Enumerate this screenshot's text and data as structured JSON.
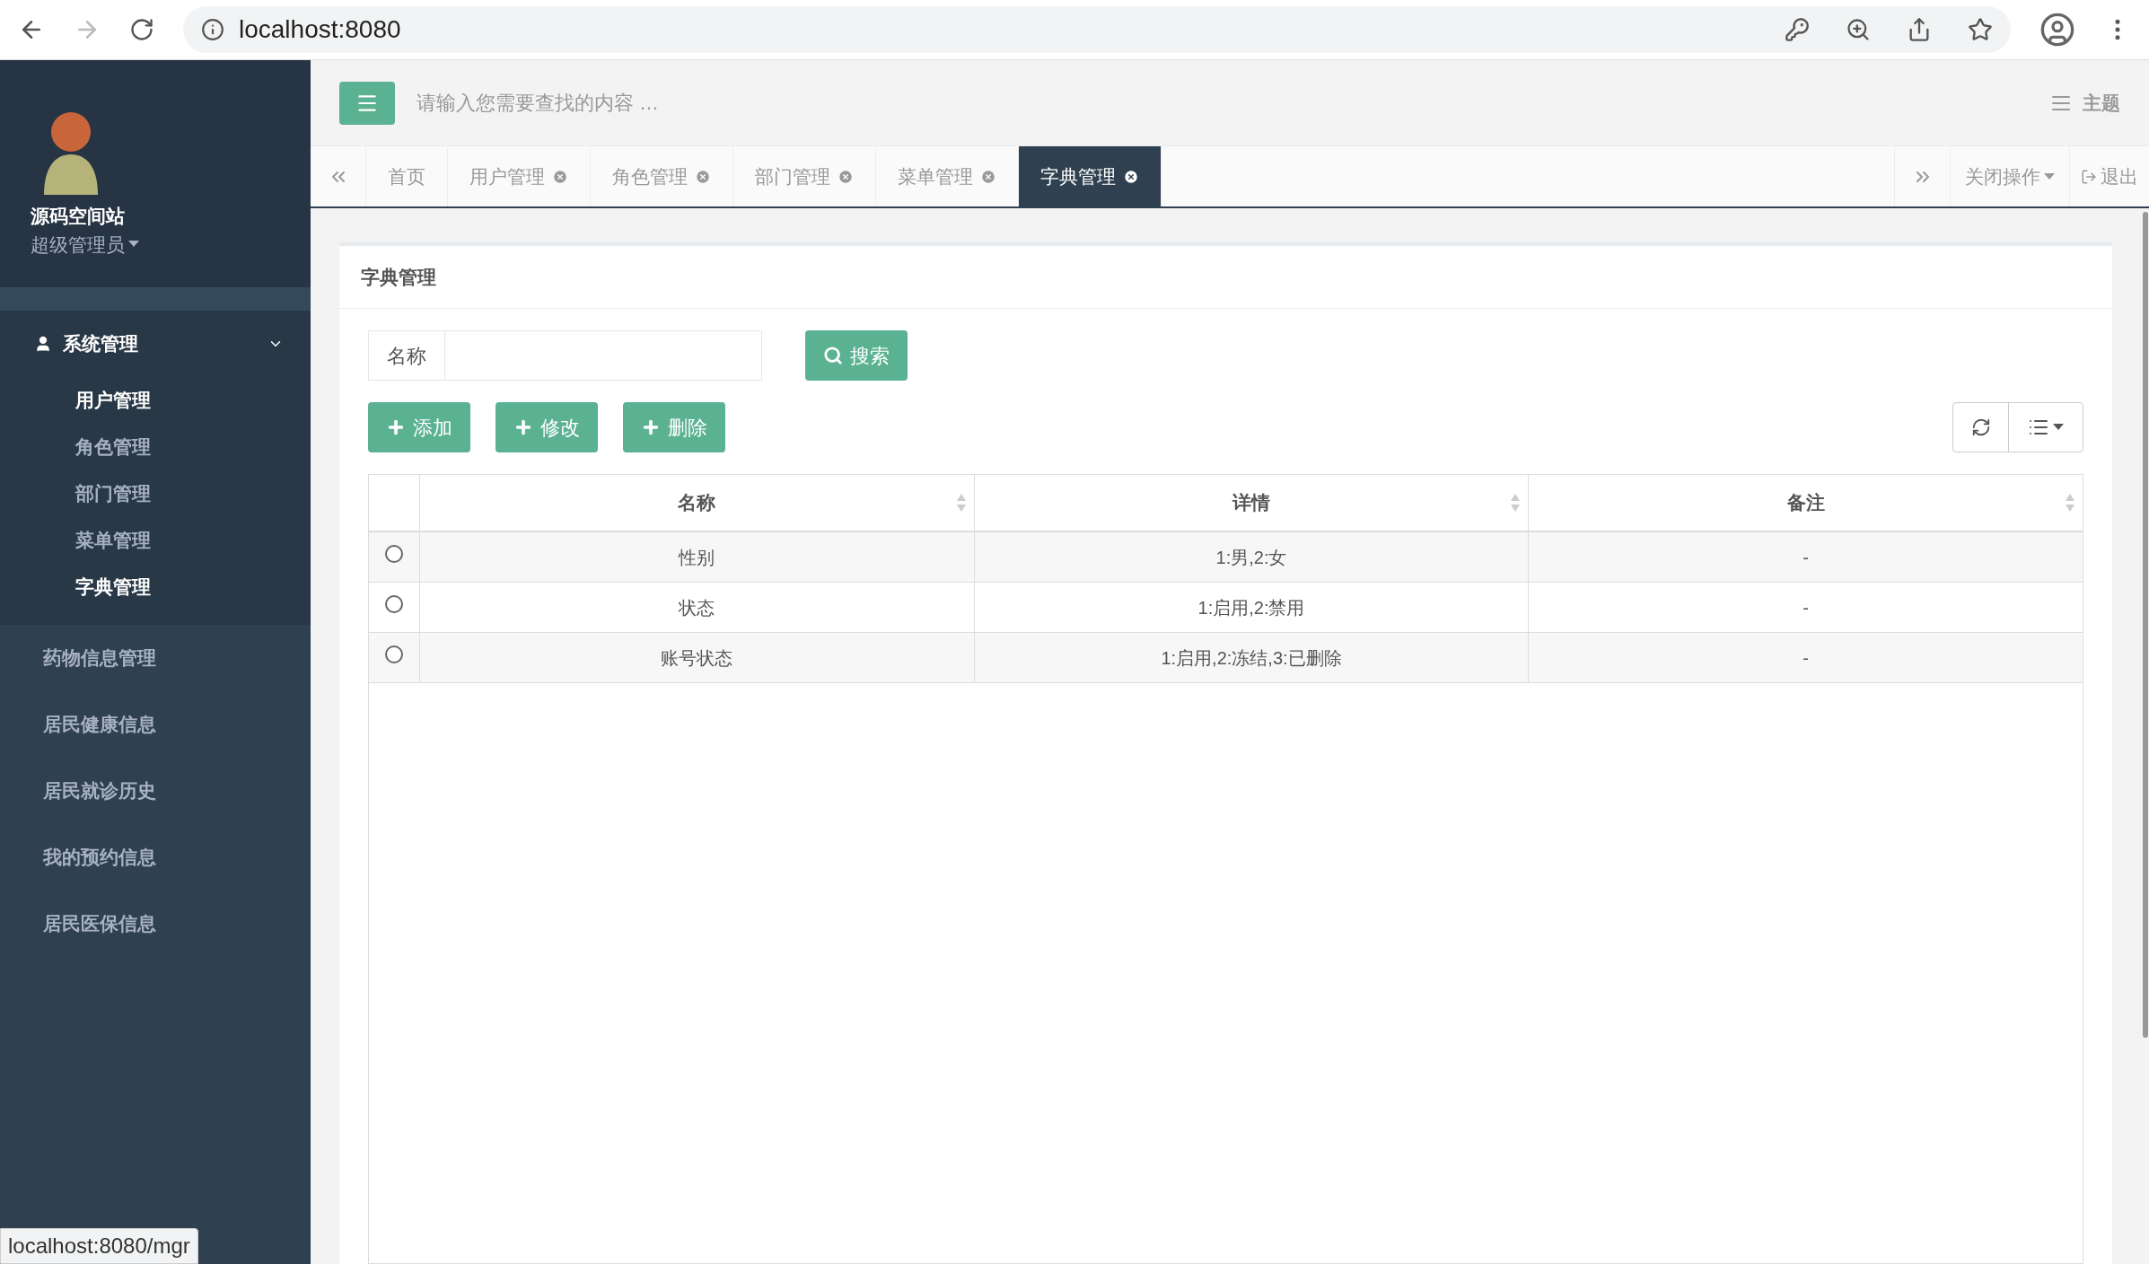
{
  "browser": {
    "url": "localhost:8080",
    "status_url": "localhost:8080/mgr"
  },
  "sidebar": {
    "user_name": "源码空间站",
    "user_role": "超级管理员",
    "groups": [
      {
        "label": "系统管理",
        "expanded": true,
        "children": [
          {
            "label": "用户管理",
            "selected": true
          },
          {
            "label": "角色管理",
            "selected": false
          },
          {
            "label": "部门管理",
            "selected": false
          },
          {
            "label": "菜单管理",
            "selected": false
          },
          {
            "label": "字典管理",
            "selected": true
          }
        ]
      },
      {
        "label": "药物信息管理",
        "expanded": false
      },
      {
        "label": "居民健康信息",
        "expanded": false
      },
      {
        "label": "居民就诊历史",
        "expanded": false
      },
      {
        "label": "我的预约信息",
        "expanded": false
      },
      {
        "label": "居民医保信息",
        "expanded": false
      }
    ]
  },
  "header": {
    "search_placeholder": "请输入您需要查找的内容 …",
    "theme": "主题"
  },
  "tabs": [
    {
      "label": "首页",
      "closable": false,
      "selected": false
    },
    {
      "label": "用户管理",
      "closable": true,
      "selected": false
    },
    {
      "label": "角色管理",
      "closable": true,
      "selected": false
    },
    {
      "label": "部门管理",
      "closable": true,
      "selected": false
    },
    {
      "label": "菜单管理",
      "closable": true,
      "selected": false
    },
    {
      "label": "字典管理",
      "closable": true,
      "selected": true
    }
  ],
  "tab_actions": {
    "close_ops": "关闭操作",
    "logout": "退出"
  },
  "panel": {
    "title": "字典管理",
    "filter_label": "名称",
    "search_button": "搜索",
    "actions": [
      "添加",
      "修改",
      "删除"
    ]
  },
  "table": {
    "columns": [
      "名称",
      "详情",
      "备注"
    ],
    "rows": [
      {
        "cells": [
          "性别",
          "1:男,2:女",
          "-"
        ],
        "selected": false
      },
      {
        "cells": [
          "状态",
          "1:启用,2:禁用",
          "-"
        ],
        "selected": false
      },
      {
        "cells": [
          "账号状态",
          "1:启用,2:冻结,3:已删除",
          "-"
        ],
        "selected": false
      }
    ]
  }
}
